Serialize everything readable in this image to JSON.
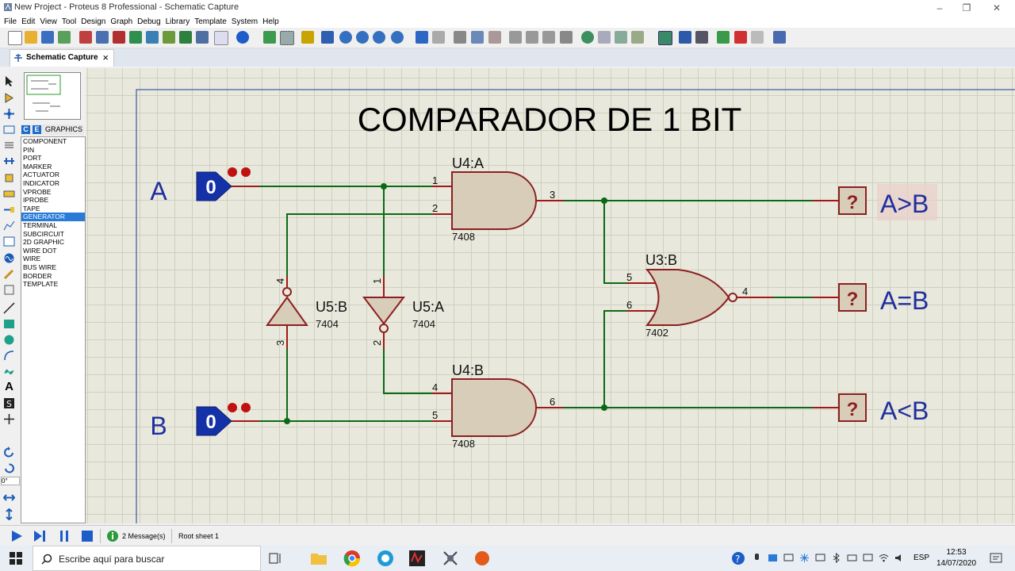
{
  "window": {
    "title": "New Project - Proteus 8 Professional - Schematic Capture"
  },
  "menu": [
    "File",
    "Edit",
    "View",
    "Tool",
    "Design",
    "Graph",
    "Debug",
    "Library",
    "Template",
    "System",
    "Help"
  ],
  "tab": {
    "label": "Schematic Capture"
  },
  "mode_panel": {
    "header": "GRAPHICS",
    "items": [
      "COMPONENT",
      "PIN",
      "PORT",
      "MARKER",
      "ACTUATOR",
      "INDICATOR",
      "VPROBE",
      "IPROBE",
      "TAPE",
      "GENERATOR",
      "TERMINAL",
      "SUBCIRCUIT",
      "2D GRAPHIC",
      "WIRE DOT",
      "WIRE",
      "BUS WIRE",
      "BORDER",
      "TEMPLATE"
    ],
    "selected": "GENERATOR",
    "rotation": "0°"
  },
  "schematic": {
    "title": "COMPARADOR DE 1 BIT",
    "inputs": [
      {
        "label": "A",
        "state": "0"
      },
      {
        "label": "B",
        "state": "0"
      }
    ],
    "gates": [
      {
        "ref": "U4:A",
        "part": "7408",
        "pins": [
          "1",
          "2",
          "3"
        ]
      },
      {
        "ref": "U4:B",
        "part": "7408",
        "pins": [
          "4",
          "5",
          "6"
        ]
      },
      {
        "ref": "U3:B",
        "part": "7402",
        "pins": [
          "5",
          "6",
          "4"
        ]
      },
      {
        "ref": "U5:B",
        "part": "7404",
        "pins": [
          "4",
          "3"
        ]
      },
      {
        "ref": "U5:A",
        "part": "7404",
        "pins": [
          "1",
          "2"
        ]
      }
    ],
    "outputs": [
      {
        "label": "A>B",
        "state": "?"
      },
      {
        "label": "A=B",
        "state": "?"
      },
      {
        "label": "A<B",
        "state": "?"
      }
    ]
  },
  "status": {
    "messages": "2 Message(s)",
    "sheet": "Root sheet 1"
  },
  "taskbar": {
    "search_placeholder": "Escribe aquí para buscar",
    "language": "ESP",
    "time": "12:53",
    "date": "14/07/2020"
  },
  "colors": {
    "wire": "#006400",
    "gate_fill": "#d8cdb8",
    "gate_stroke": "#8b2020",
    "generator": "#1531a8",
    "label_blue": "#1f2f9e",
    "canvas": "#e8e8dc"
  }
}
